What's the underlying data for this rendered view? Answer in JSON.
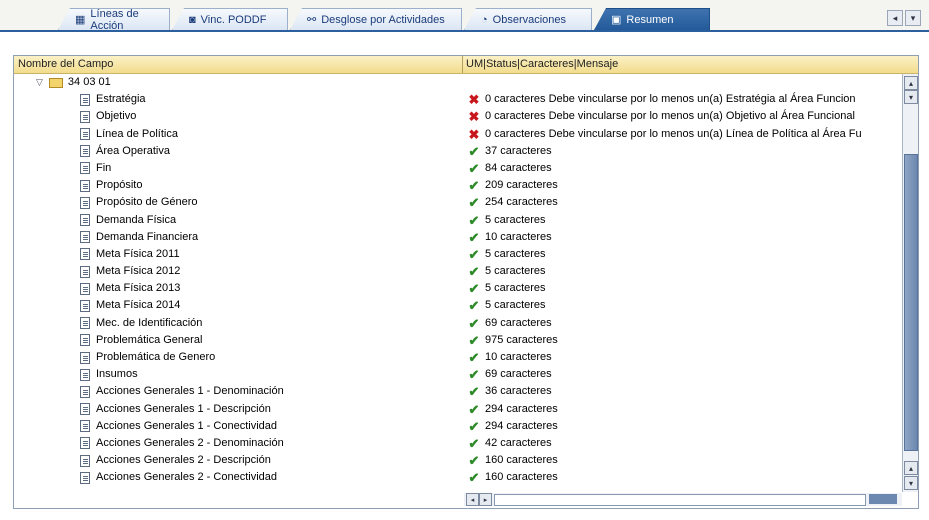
{
  "tabs": [
    {
      "label": "Líneas de Acción",
      "icon": "table-icon"
    },
    {
      "label": "Vinc. PODDF",
      "icon": "link-icon"
    },
    {
      "label": "Desglose por Actividades",
      "icon": "activities-icon"
    },
    {
      "label": "Observaciones",
      "icon": "observations-icon"
    },
    {
      "label": "Resumen",
      "icon": "summary-icon"
    }
  ],
  "active_tab": "Resumen",
  "table": {
    "col1": "Nombre del Campo",
    "col2": "UM|Status|Caracteres|Mensaje",
    "root_label": "34 03 01",
    "rows": [
      {
        "name": "Estratégia",
        "status": "error",
        "value": "0 caracteres Debe vincularse por lo menos un(a) Estratégia al Área Funcion"
      },
      {
        "name": "Objetivo",
        "status": "error",
        "value": "0 caracteres Debe vincularse por lo menos un(a) Objetivo al Área Funcional"
      },
      {
        "name": "Línea de Política",
        "status": "error",
        "value": "0 caracteres Debe vincularse por lo menos un(a) Línea de Política al Área Fu"
      },
      {
        "name": "Área Operativa",
        "status": "ok",
        "value": "37 caracteres"
      },
      {
        "name": "Fin",
        "status": "ok",
        "value": "84 caracteres"
      },
      {
        "name": "Propósito",
        "status": "ok",
        "value": "209 caracteres"
      },
      {
        "name": "Propósito de Género",
        "status": "ok",
        "value": "254 caracteres"
      },
      {
        "name": "Demanda Física",
        "status": "ok",
        "value": "5 caracteres"
      },
      {
        "name": "Demanda Financiera",
        "status": "ok",
        "value": "10 caracteres"
      },
      {
        "name": "Meta Física 2011",
        "status": "ok",
        "value": "5 caracteres"
      },
      {
        "name": "Meta Física 2012",
        "status": "ok",
        "value": "5 caracteres"
      },
      {
        "name": "Meta Física 2013",
        "status": "ok",
        "value": "5 caracteres"
      },
      {
        "name": "Meta Física 2014",
        "status": "ok",
        "value": "5 caracteres"
      },
      {
        "name": "Mec. de Identificación",
        "status": "ok",
        "value": "69 caracteres"
      },
      {
        "name": "Problemática General",
        "status": "ok",
        "value": "975 caracteres"
      },
      {
        "name": "Problemática de Genero",
        "status": "ok",
        "value": "10 caracteres"
      },
      {
        "name": "Insumos",
        "status": "ok",
        "value": "69 caracteres"
      },
      {
        "name": "Acciones Generales 1 - Denominación",
        "status": "ok",
        "value": "36 caracteres"
      },
      {
        "name": "Acciones Generales 1 - Descripción",
        "status": "ok",
        "value": "294 caracteres"
      },
      {
        "name": "Acciones Generales 1 - Conectividad",
        "status": "ok",
        "value": "294 caracteres"
      },
      {
        "name": "Acciones Generales 2 - Denominación",
        "status": "ok",
        "value": "42 caracteres"
      },
      {
        "name": "Acciones Generales 2 - Descripción",
        "status": "ok",
        "value": "160 caracteres"
      },
      {
        "name": "Acciones Generales 2 - Conectividad",
        "status": "ok",
        "value": "160 caracteres"
      }
    ]
  },
  "colors": {
    "ok": "#2f8a2a",
    "error": "#c8161d",
    "header": "#f2dc8c",
    "tab_active": "#245a99"
  }
}
